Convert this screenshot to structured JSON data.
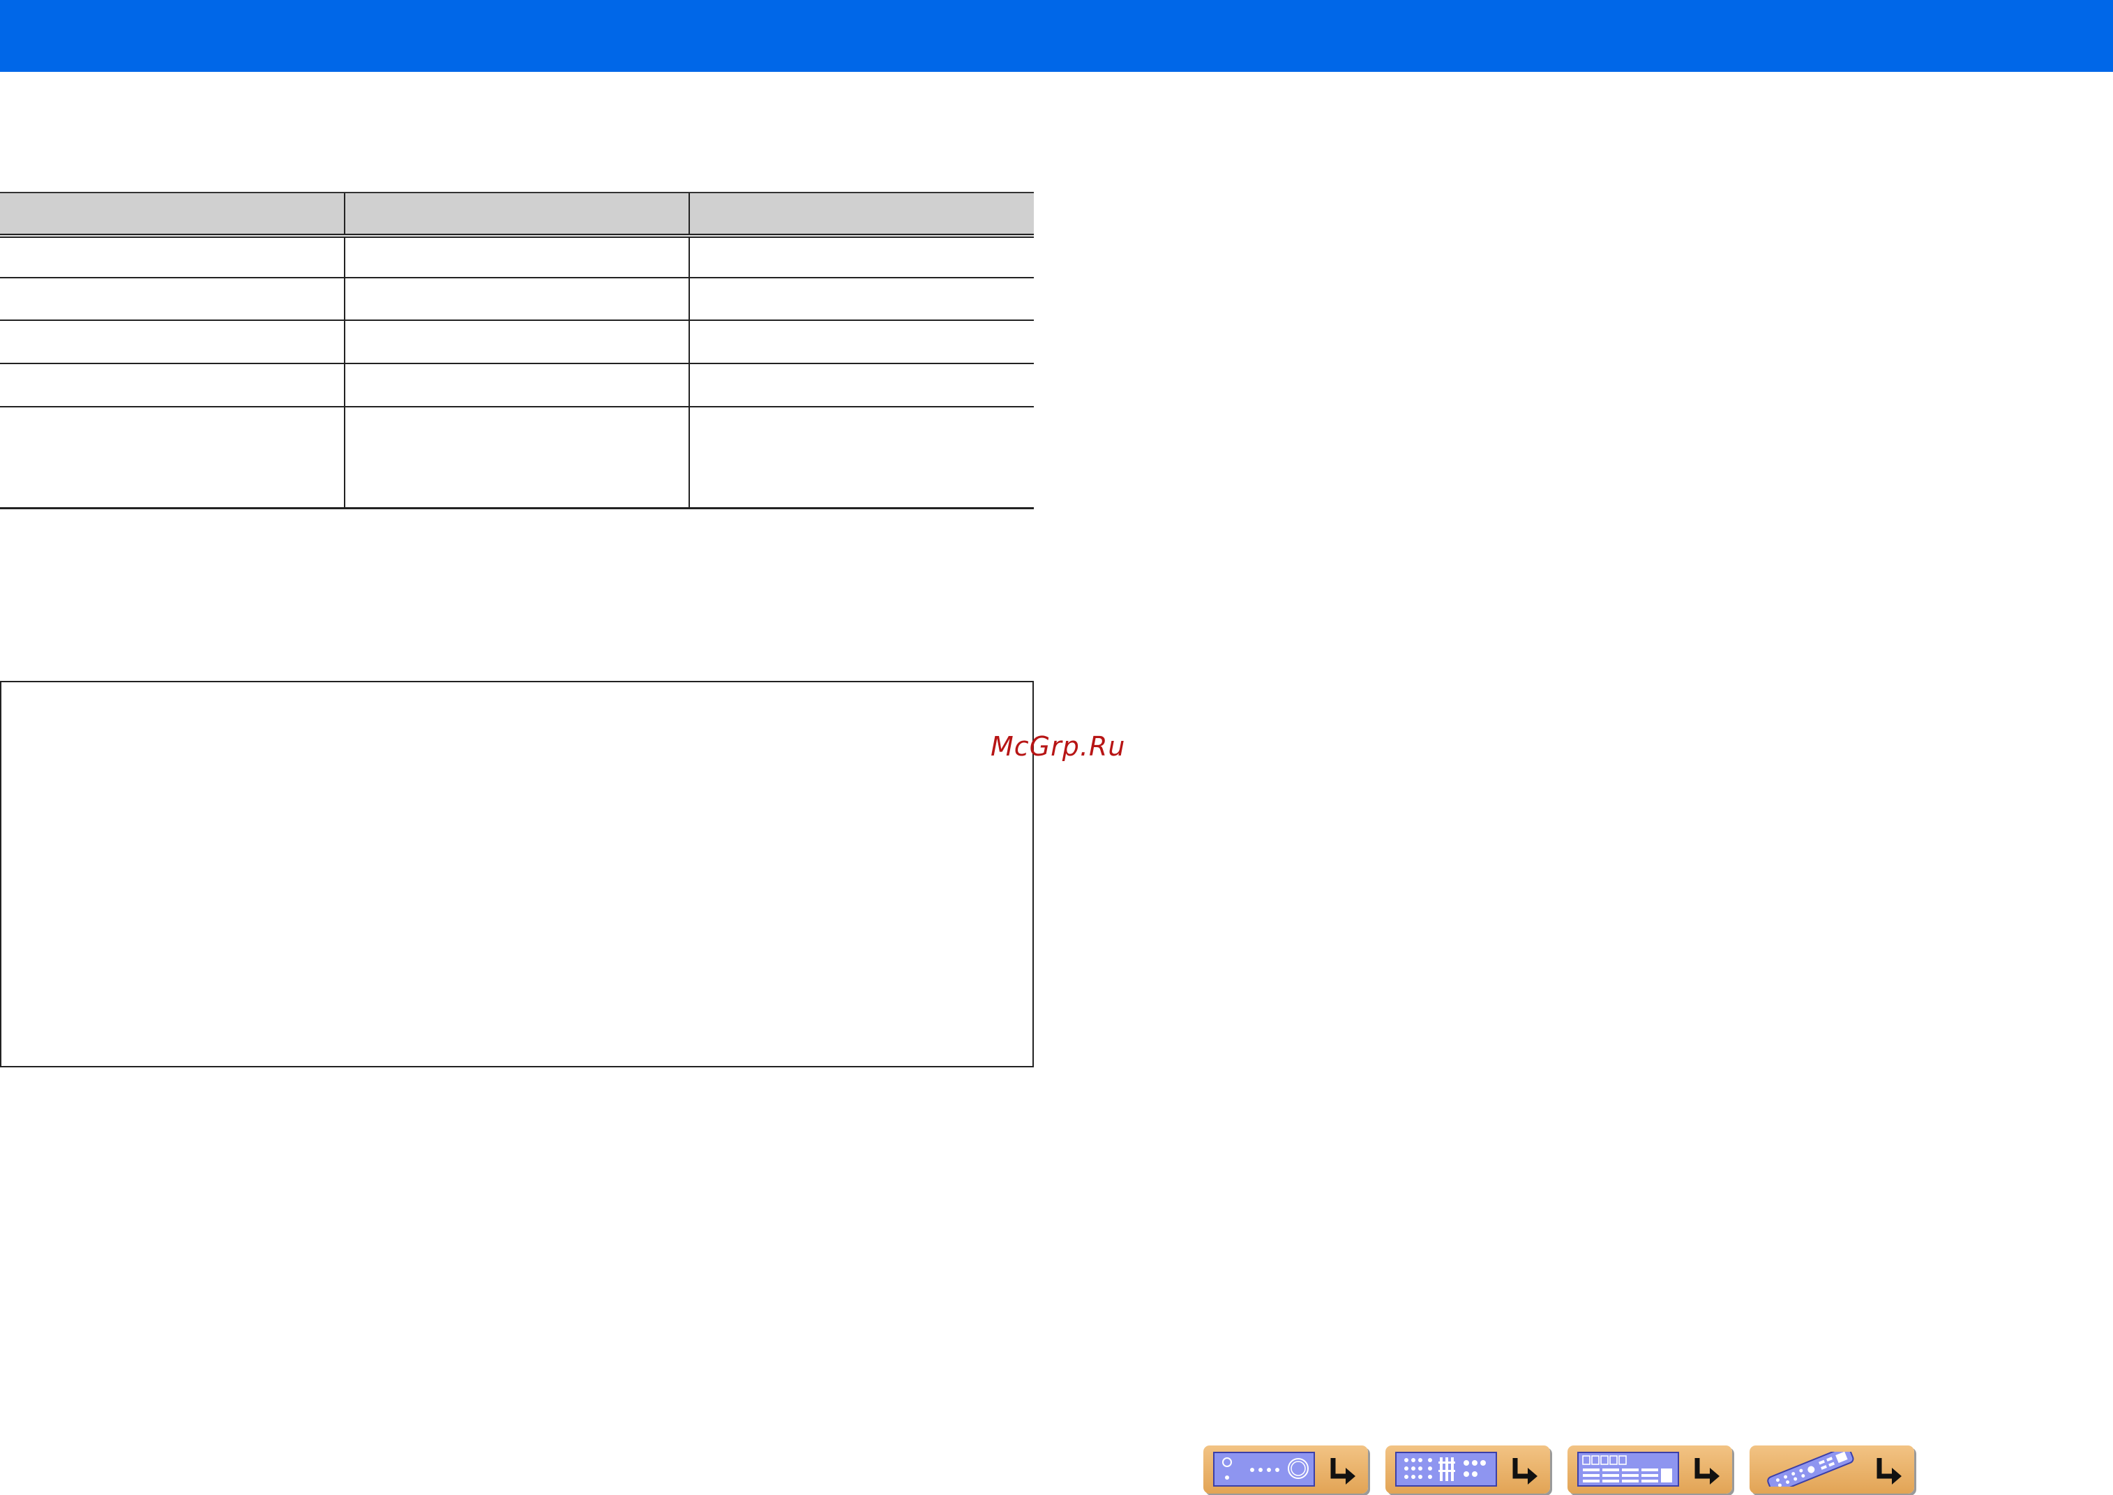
{
  "watermark": "McGrp.Ru",
  "table": {
    "headers": [
      "",
      "",
      ""
    ],
    "rows": [
      [
        "",
        "",
        ""
      ],
      [
        "",
        "",
        ""
      ],
      [
        "",
        "",
        ""
      ],
      [
        "",
        "",
        ""
      ],
      [
        "",
        "",
        ""
      ]
    ]
  },
  "nav_buttons": [
    {
      "icon": "front-panel-icon"
    },
    {
      "icon": "rear-panel-icon"
    },
    {
      "icon": "front-display-icon"
    },
    {
      "icon": "remote-control-icon"
    }
  ],
  "colors": {
    "header": "#0067e8",
    "table_header": "#d0d0d0",
    "nav_button": "#e8b36b",
    "nav_thumb": "#8e95f0",
    "watermark": "#b71515"
  }
}
